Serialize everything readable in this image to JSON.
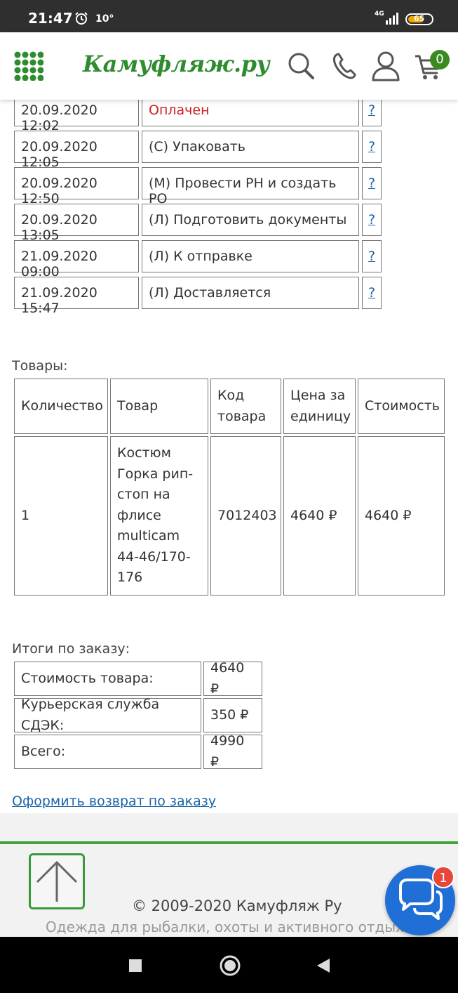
{
  "status_bar": {
    "time": "21:47",
    "temperature": "10°",
    "network": "4G",
    "battery": "65"
  },
  "header": {
    "logo_text": "Камуфляж.ру",
    "cart_count": "0"
  },
  "history": [
    {
      "date": "20.09.2020 12:02",
      "status": "Оплачен",
      "help": "?"
    },
    {
      "date": "20.09.2020 12:05",
      "status": "(С) Упаковать",
      "help": "?"
    },
    {
      "date": "20.09.2020 12:50",
      "status": "(М) Провести РН и создать РО",
      "help": "?"
    },
    {
      "date": "20.09.2020 13:05",
      "status": "(Л) Подготовить документы",
      "help": "?"
    },
    {
      "date": "21.09.2020 09:00",
      "status": "(Л) К отправке",
      "help": "?"
    },
    {
      "date": "21.09.2020 15:47",
      "status": "(Л) Доставляется",
      "help": "?"
    }
  ],
  "goods": {
    "label": "Товары:",
    "headers": [
      "Количество",
      "Товар",
      "Код товара",
      "Цена за единицу",
      "Стоимость"
    ],
    "rows": [
      {
        "qty": "1",
        "name": "Костюм Горка рип-стоп на флисе multicam 44-46/170-176",
        "code": "7012403",
        "price": "4640 ₽",
        "total": "4640 ₽"
      }
    ]
  },
  "totals": {
    "label": "Итоги по заказу:",
    "rows": [
      {
        "name": "Стоимость товара:",
        "value": "4640 ₽"
      },
      {
        "name": "Курьерская служба СДЭК:",
        "value": "350 ₽"
      },
      {
        "name": "Всего:",
        "value": "4990 ₽"
      }
    ]
  },
  "return_link": "Оформить возврат по заказу",
  "footer": {
    "copyright": "© 2009-2020 Камуфляж Ру",
    "tagline": "Одежда для рыбалки, охоты и активного отдыха"
  },
  "chat": {
    "badge": "1"
  },
  "colors": {
    "brand_green": "#2e8c2e",
    "link_blue": "#1a64a8",
    "status_red": "#cc2020",
    "chat_blue": "#1f6fd6"
  }
}
